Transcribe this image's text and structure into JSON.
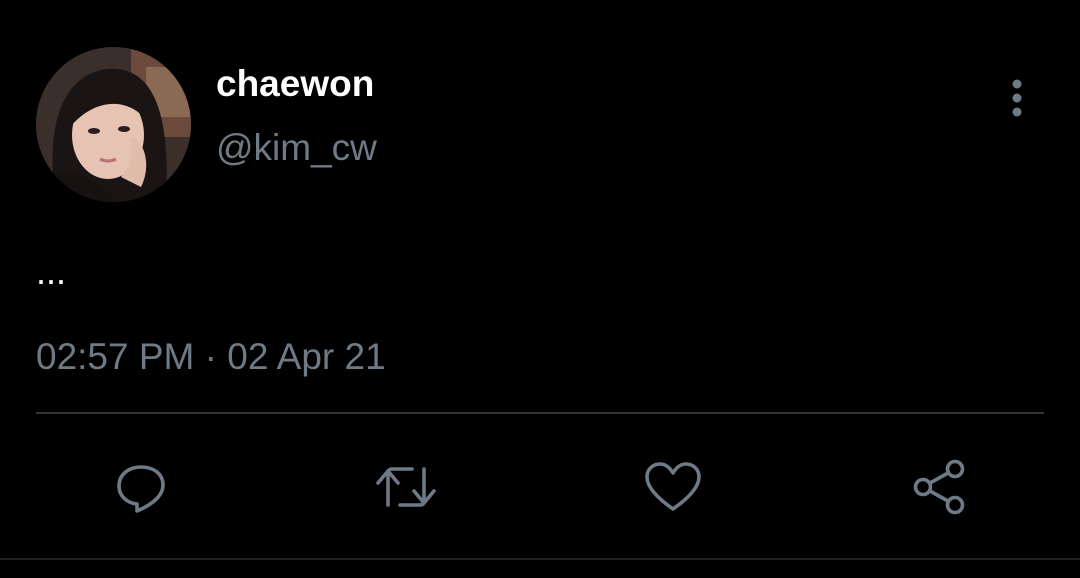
{
  "tweet": {
    "display_name": "chaewon",
    "handle": "@kim_cw",
    "text": "...",
    "time": "02:57 PM",
    "separator": "·",
    "date": "02 Apr 21"
  },
  "icons": {
    "more": "more-vertical-icon",
    "reply": "reply-icon",
    "retweet": "retweet-icon",
    "like": "heart-icon",
    "share": "share-icon"
  },
  "colors": {
    "background": "#000000",
    "primary_text": "#ffffff",
    "secondary_text": "#6e7a85",
    "divider": "#2f3336"
  }
}
